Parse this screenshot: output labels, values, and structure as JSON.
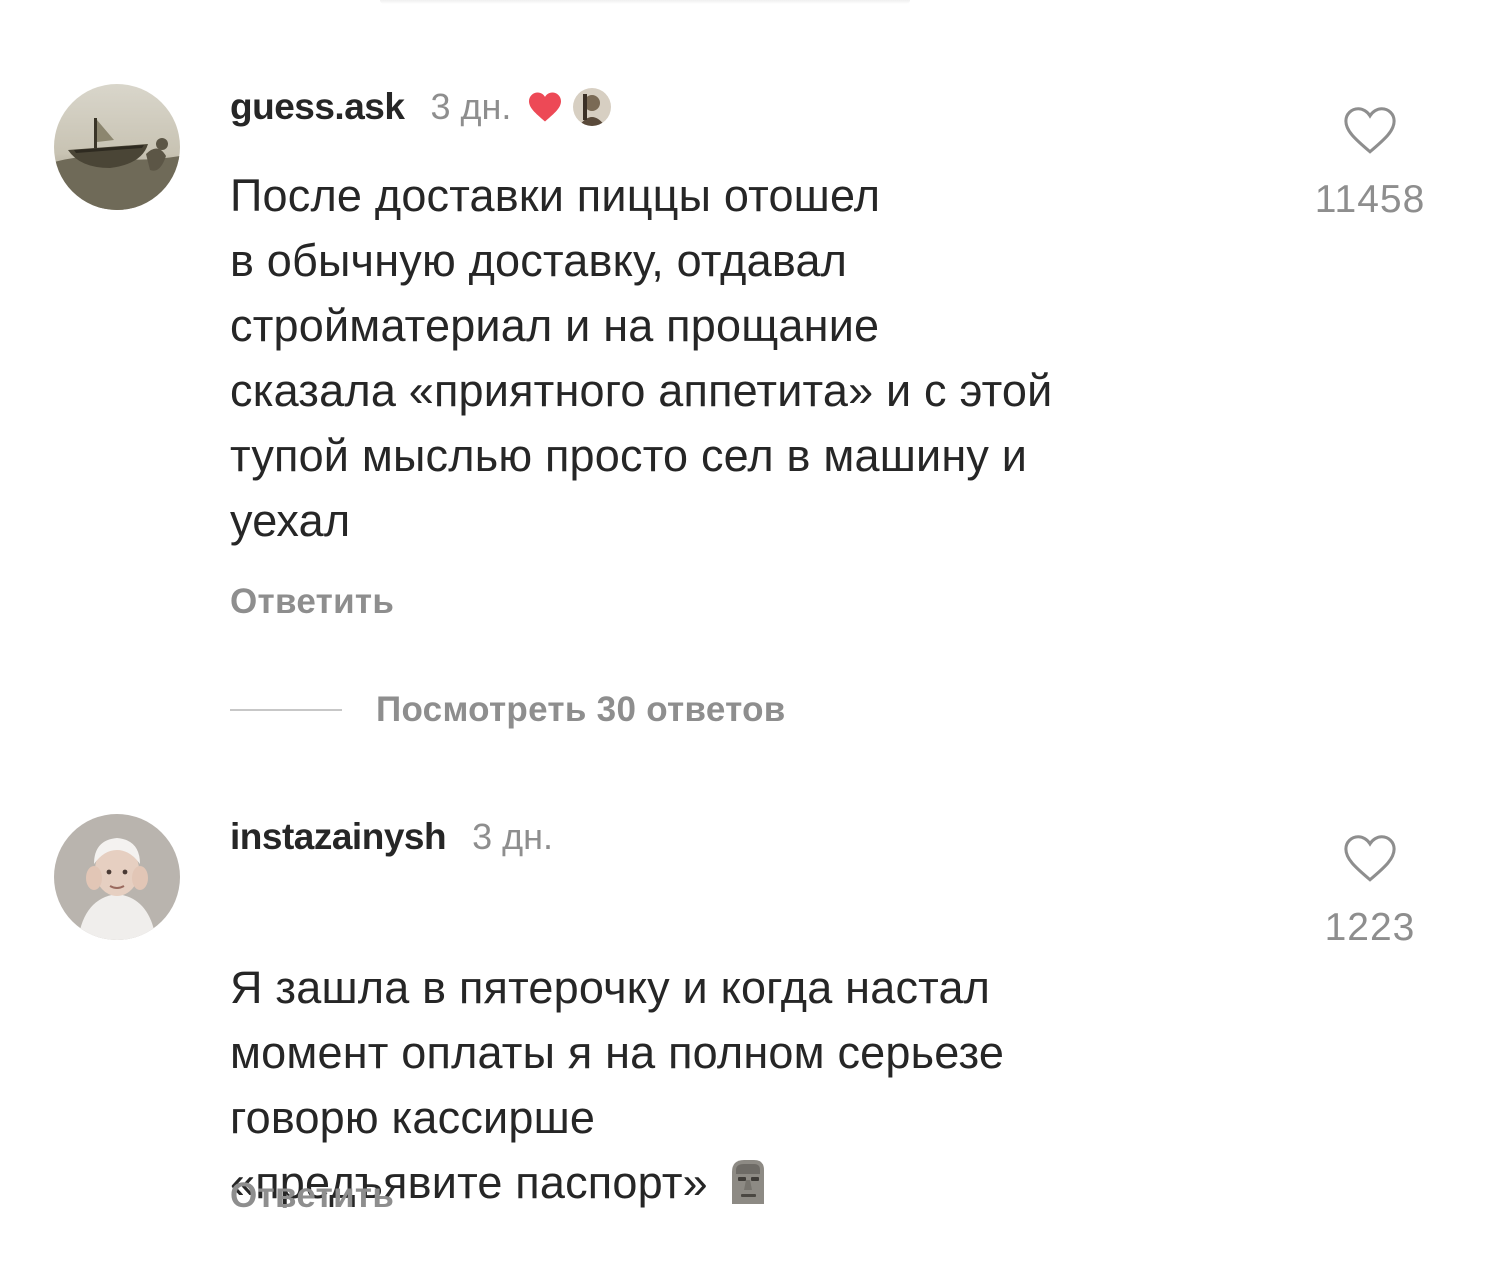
{
  "comments": [
    {
      "username": "guess.ask",
      "time": "3 дн.",
      "text": "После доставки пиццы отошел\nв обычную доставку, отдавал\nстройматериал и на прощание\nсказала «приятного аппетита» и с этой\nтупой мыслью просто сел в машину и\nуехал",
      "reply_label": "Ответить",
      "like_count": "11458",
      "liked_by_author": true,
      "avatar_icon": "boat-photo-avatar",
      "like_icon": "heart-outline-icon"
    },
    {
      "username": "instazainysh",
      "time": "3 дн.",
      "text": "Я зашла в пятерочку и когда настал\nмомент оплаты я на полном серьезе\nговорю кассирше\n«предъявите паспорт»",
      "reply_label": "Ответить",
      "like_count": "1223",
      "trailing_emoji": "moai-emoji",
      "avatar_icon": "person-photo-avatar",
      "like_icon": "heart-outline-icon"
    }
  ],
  "view_replies": {
    "label": "Посмотреть 30 ответов"
  },
  "colors": {
    "text_primary": "#262626",
    "text_secondary": "#8e8e8e",
    "heart_red": "#ed4956",
    "divider": "#c7c7c7",
    "background": "#ffffff"
  }
}
